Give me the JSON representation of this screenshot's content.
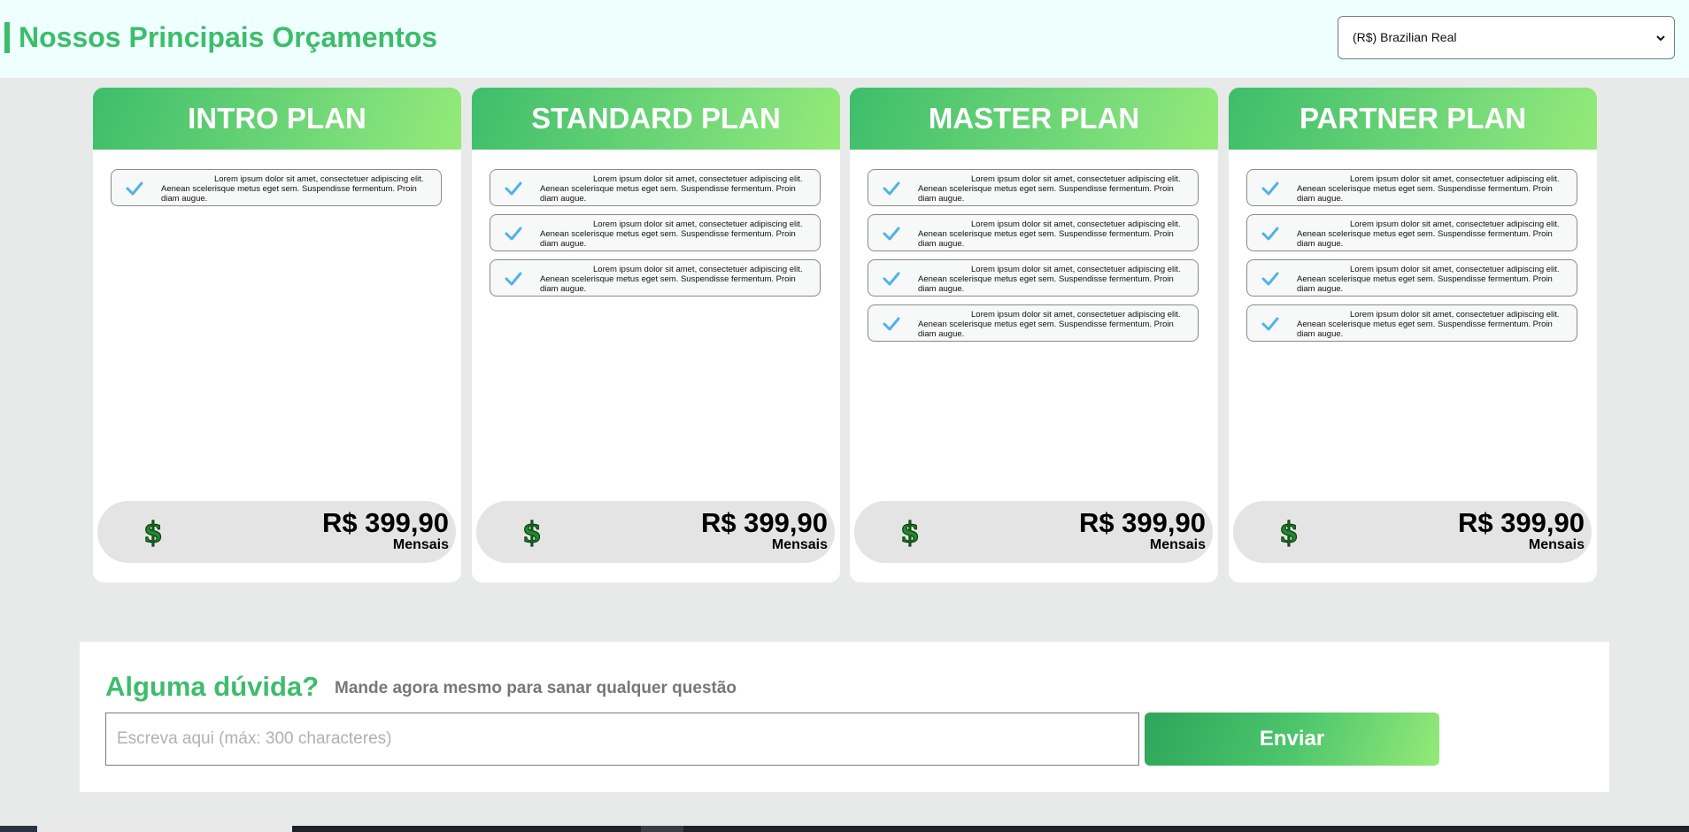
{
  "header": {
    "title": "Nossos Principais Orçamentos",
    "currency_select": {
      "selected": "(R$) Brazilian Real",
      "icon": "chevron-down-icon"
    }
  },
  "colors": {
    "brand_green": "#3dbd6b",
    "gradient_light": "#95ea78",
    "check_blue": "#4fb3e8",
    "dollar_green": "#1f8a2b"
  },
  "plans": [
    {
      "name": "INTRO PLAN",
      "features": [
        "Lorem ipsum dolor sit amet, consectetuer adipiscing elit. Aenean scelerisque metus eget sem. Suspendisse fermentum. Proin diam augue."
      ],
      "price": "R$ 399,90",
      "period": "Mensais"
    },
    {
      "name": "STANDARD PLAN",
      "features": [
        "Lorem ipsum dolor sit amet, consectetuer adipiscing elit. Aenean scelerisque metus eget sem. Suspendisse fermentum. Proin diam augue.",
        "Lorem ipsum dolor sit amet, consectetuer adipiscing elit. Aenean scelerisque metus eget sem. Suspendisse fermentum. Proin diam augue.",
        "Lorem ipsum dolor sit amet, consectetuer adipiscing elit. Aenean scelerisque metus eget sem. Suspendisse fermentum. Proin diam augue."
      ],
      "price": "R$ 399,90",
      "period": "Mensais"
    },
    {
      "name": "MASTER PLAN",
      "features": [
        "Lorem ipsum dolor sit amet, consectetuer adipiscing elit. Aenean scelerisque metus eget sem. Suspendisse fermentum. Proin diam augue.",
        "Lorem ipsum dolor sit amet, consectetuer adipiscing elit. Aenean scelerisque metus eget sem. Suspendisse fermentum. Proin diam augue.",
        "Lorem ipsum dolor sit amet, consectetuer adipiscing elit. Aenean scelerisque metus eget sem. Suspendisse fermentum. Proin diam augue.",
        "Lorem ipsum dolor sit amet, consectetuer adipiscing elit. Aenean scelerisque metus eget sem. Suspendisse fermentum. Proin diam augue."
      ],
      "price": "R$ 399,90",
      "period": "Mensais"
    },
    {
      "name": "PARTNER PLAN",
      "features": [
        "Lorem ipsum dolor sit amet, consectetuer adipiscing elit. Aenean scelerisque metus eget sem. Suspendisse fermentum. Proin diam augue.",
        "Lorem ipsum dolor sit amet, consectetuer adipiscing elit. Aenean scelerisque metus eget sem. Suspendisse fermentum. Proin diam augue.",
        "Lorem ipsum dolor sit amet, consectetuer adipiscing elit. Aenean scelerisque metus eget sem. Suspendisse fermentum. Proin diam augue.",
        "Lorem ipsum dolor sit amet, consectetuer adipiscing elit. Aenean scelerisque metus eget sem. Suspendisse fermentum. Proin diam augue."
      ],
      "price": "R$ 399,90",
      "period": "Mensais"
    }
  ],
  "contact": {
    "heading": "Alguma dúvida?",
    "subheading": "Mande agora mesmo para sanar qualquer questão",
    "input_placeholder": "Escreva aqui (máx: 300 characteres)",
    "send_label": "Enviar"
  }
}
